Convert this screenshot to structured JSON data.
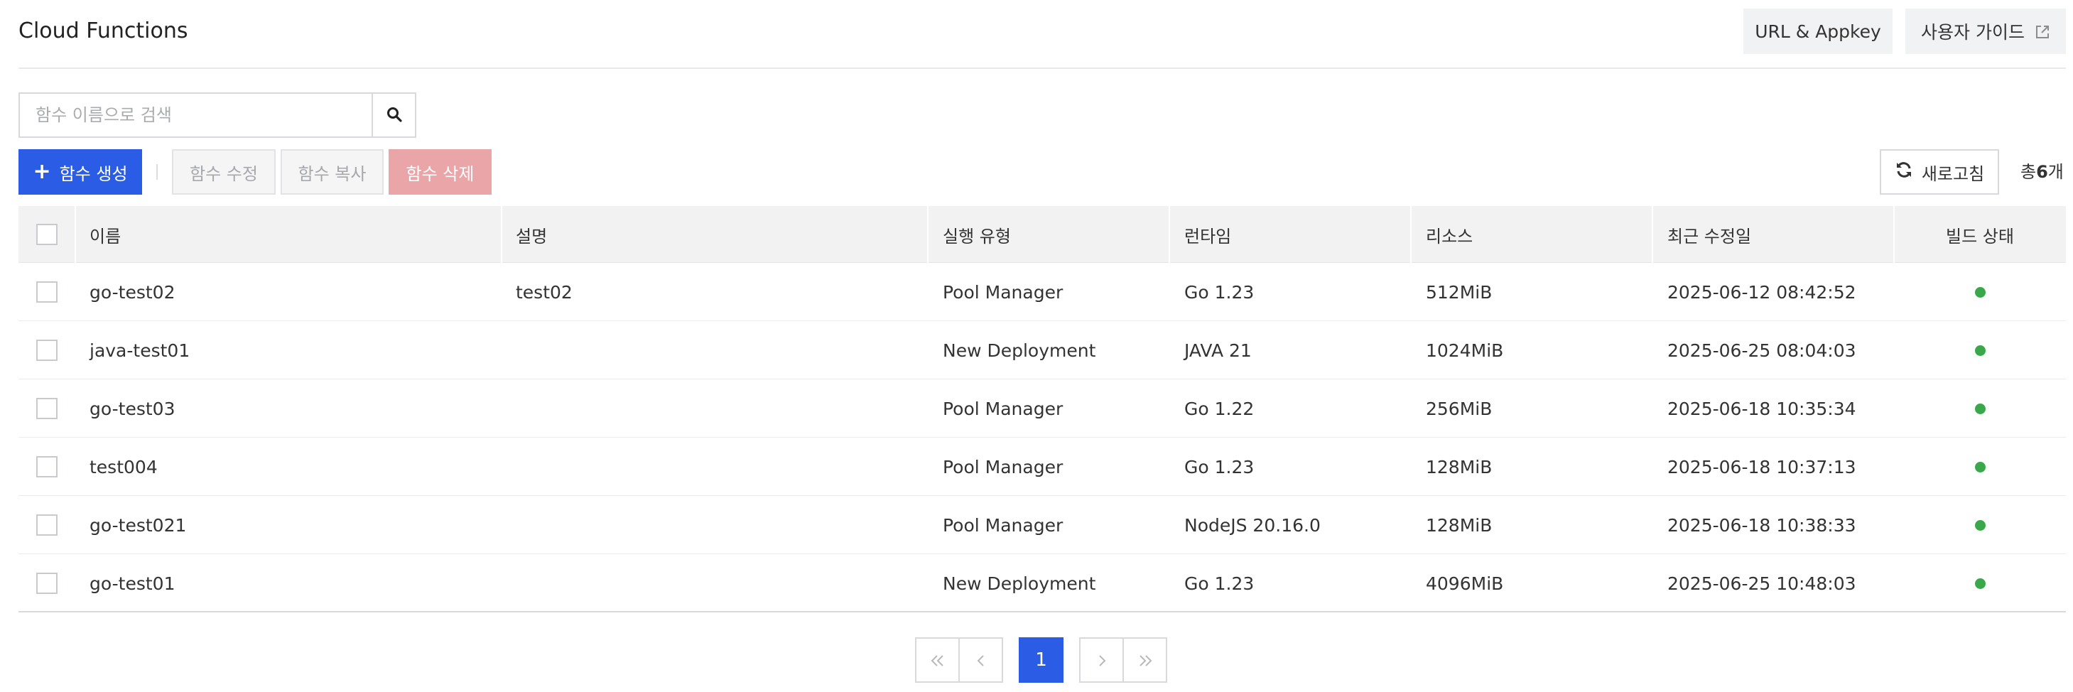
{
  "header": {
    "title": "Cloud Functions",
    "url_appkey_label": "URL & Appkey",
    "user_guide_label": "사용자 가이드"
  },
  "search": {
    "placeholder": "함수 이름으로 검색",
    "value": ""
  },
  "toolbar": {
    "create_label": "함수 생성",
    "edit_label": "함수 수정",
    "copy_label": "함수 복사",
    "delete_label": "함수 삭제",
    "refresh_label": "새로고침",
    "total_prefix": "총",
    "total_count": "6",
    "total_suffix": "개"
  },
  "table": {
    "columns": [
      "이름",
      "설명",
      "실행 유형",
      "런타임",
      "리소스",
      "최근 수정일",
      "빌드 상태"
    ],
    "rows": [
      {
        "name": "go-test02",
        "description": "test02",
        "exec_type": "Pool Manager",
        "runtime": "Go 1.23",
        "resource": "512MiB",
        "modified": "2025-06-12 08:42:52",
        "build_status": "success"
      },
      {
        "name": "java-test01",
        "description": "",
        "exec_type": "New Deployment",
        "runtime": "JAVA 21",
        "resource": "1024MiB",
        "modified": "2025-06-25 08:04:03",
        "build_status": "success"
      },
      {
        "name": "go-test03",
        "description": "",
        "exec_type": "Pool Manager",
        "runtime": "Go 1.22",
        "resource": "256MiB",
        "modified": "2025-06-18 10:35:34",
        "build_status": "success"
      },
      {
        "name": "test004",
        "description": "",
        "exec_type": "Pool Manager",
        "runtime": "Go 1.23",
        "resource": "128MiB",
        "modified": "2025-06-18 10:37:13",
        "build_status": "success"
      },
      {
        "name": "go-test021",
        "description": "",
        "exec_type": "Pool Manager",
        "runtime": "NodeJS 20.16.0",
        "resource": "128MiB",
        "modified": "2025-06-18 10:38:33",
        "build_status": "success"
      },
      {
        "name": "go-test01",
        "description": "",
        "exec_type": "New Deployment",
        "runtime": "Go 1.23",
        "resource": "4096MiB",
        "modified": "2025-06-25 10:48:03",
        "build_status": "success"
      }
    ]
  },
  "pagination": {
    "current_page": "1",
    "first_icon": "double-chevron-left-icon",
    "prev_icon": "chevron-left-icon",
    "next_icon": "chevron-right-icon",
    "last_icon": "double-chevron-right-icon"
  },
  "colors": {
    "primary": "#2a5ce5",
    "danger_disabled": "#eaa5a8",
    "status_success": "#3aa74b"
  }
}
